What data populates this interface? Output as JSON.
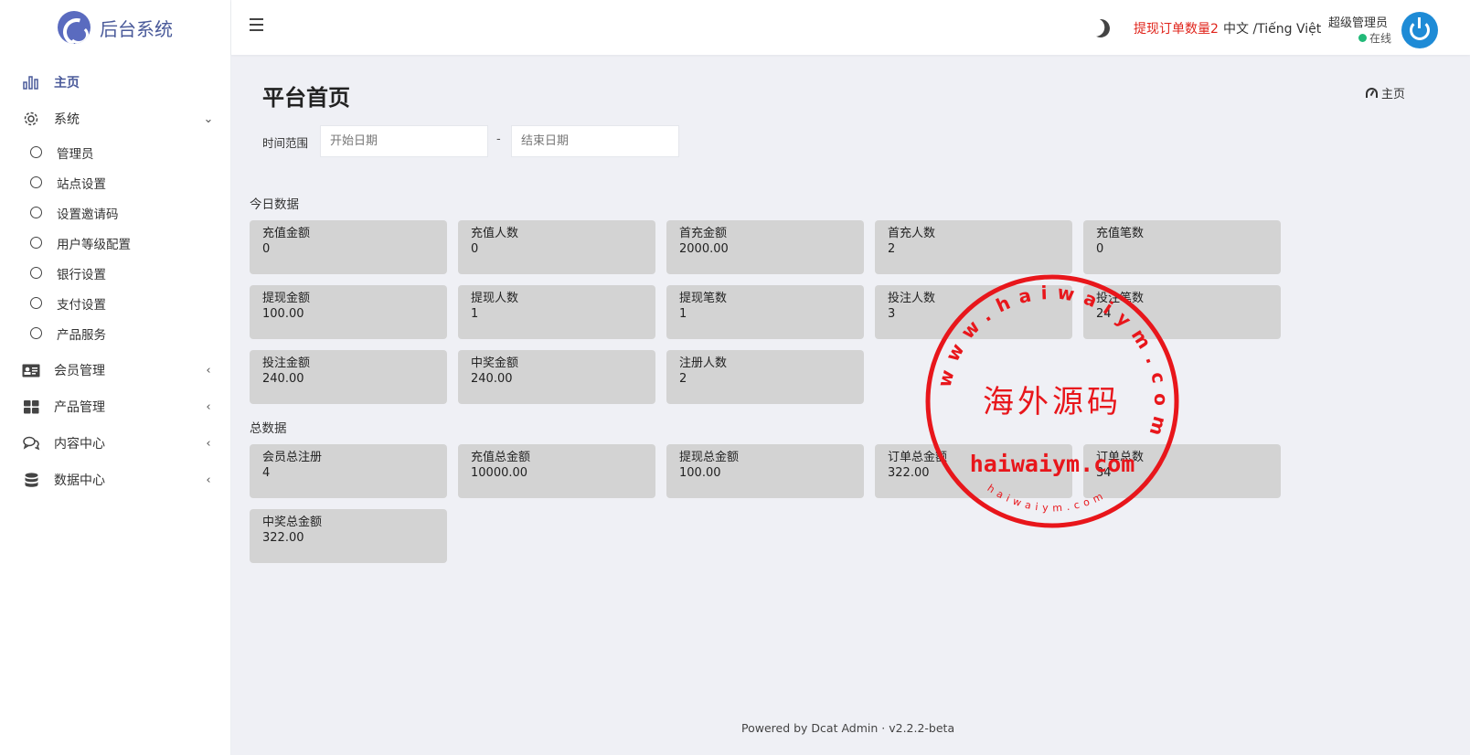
{
  "brand": {
    "name": "后台系统"
  },
  "sidebar": {
    "items": [
      {
        "label": "主页",
        "icon": "bar-chart-icon"
      },
      {
        "label": "系统",
        "icon": "gear-icon"
      },
      {
        "label": "会员管理",
        "icon": "id-card-icon"
      },
      {
        "label": "产品管理",
        "icon": "grid-icon"
      },
      {
        "label": "内容中心",
        "icon": "chat-icon"
      },
      {
        "label": "数据中心",
        "icon": "database-icon"
      }
    ],
    "system_sub": [
      {
        "label": "管理员"
      },
      {
        "label": "站点设置"
      },
      {
        "label": "设置邀请码"
      },
      {
        "label": "用户等级配置"
      },
      {
        "label": "银行设置"
      },
      {
        "label": "支付设置"
      },
      {
        "label": "产品服务"
      }
    ]
  },
  "topbar": {
    "withdraw_alert": "提现订单数量2",
    "language": "中文 /Tiếng Việt",
    "user_name": "超级管理员",
    "user_status": "在线"
  },
  "page": {
    "title": "平台首页",
    "breadcrumb": "主页",
    "filter": {
      "label": "时间范围",
      "start_placeholder": "开始日期",
      "separator": "-",
      "end_placeholder": "结束日期"
    }
  },
  "today": {
    "title": "今日数据",
    "cards": [
      {
        "label": "充值金额",
        "value": "0"
      },
      {
        "label": "充值人数",
        "value": "0"
      },
      {
        "label": "首充金额",
        "value": "2000.00"
      },
      {
        "label": "首充人数",
        "value": "2"
      },
      {
        "label": "充值笔数",
        "value": "0"
      },
      {
        "label": "提现金额",
        "value": "100.00"
      },
      {
        "label": "提现人数",
        "value": "1"
      },
      {
        "label": "提现笔数",
        "value": "1"
      },
      {
        "label": "投注人数",
        "value": "3"
      },
      {
        "label": "投注笔数",
        "value": "24"
      },
      {
        "label": "投注金额",
        "value": "240.00"
      },
      {
        "label": "中奖金额",
        "value": "240.00"
      },
      {
        "label": "注册人数",
        "value": "2"
      }
    ]
  },
  "total": {
    "title": "总数据",
    "cards": [
      {
        "label": "会员总注册",
        "value": "4"
      },
      {
        "label": "充值总金额",
        "value": "10000.00"
      },
      {
        "label": "提现总金额",
        "value": "100.00"
      },
      {
        "label": "订单总金额",
        "value": "322.00"
      },
      {
        "label": "订单总数",
        "value": "34"
      },
      {
        "label": "中奖总金额",
        "value": "322.00"
      }
    ]
  },
  "footer": {
    "text": "Powered by Dcat Admin  ·  v2.2.2-beta"
  },
  "watermark": {
    "ring_text": "www.haiwaiym.com",
    "center_text": "海外源码",
    "url_text": "haiwaiym.com",
    "bottom_text": "haiwaiym.com",
    "color": "#e8161b"
  }
}
